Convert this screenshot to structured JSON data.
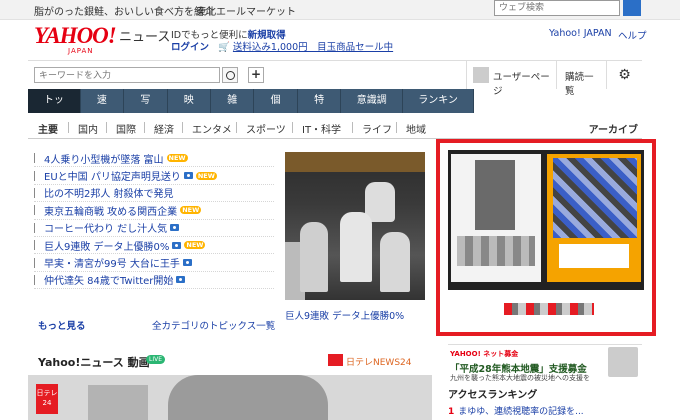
{
  "top_strip": {
    "promo": "脂がのった銀鮭、おいしい食べ方を紹介",
    "promo2": "東北エールマーケット",
    "web_search_placeholder": "ウェブ検索"
  },
  "header": {
    "logo_text": "YAHOO!",
    "logo_sub": "JAPAN",
    "logo_service": "ニュース",
    "id_prefix": "IDでもっと便利に",
    "id_link": "新規取得",
    "login": "ログイン",
    "cart_icon": "cart-icon",
    "shipping_promo": "送料込み1,000円　目玉商品セール中",
    "yahoo_japan_link": "Yahoo! JAPAN",
    "help_link": "ヘルプ"
  },
  "search": {
    "placeholder": "キーワードを入力",
    "plus_label": "+",
    "user_page": "ユーザーページ",
    "subscription": "購読一覧",
    "gear_icon": "⚙"
  },
  "main_nav": [
    {
      "label": "トップ",
      "active": true
    },
    {
      "label": "速報"
    },
    {
      "label": "写真"
    },
    {
      "label": "映像"
    },
    {
      "label": "雑誌"
    },
    {
      "label": "個人"
    },
    {
      "label": "特集"
    },
    {
      "label": "意識調査"
    },
    {
      "label": "ランキング"
    }
  ],
  "sub_nav": [
    {
      "label": "主要",
      "active": true
    },
    {
      "label": "国内"
    },
    {
      "label": "国際"
    },
    {
      "label": "経済"
    },
    {
      "label": "エンタメ"
    },
    {
      "label": "スポーツ"
    },
    {
      "label": "IT・科学"
    },
    {
      "label": "ライフ"
    },
    {
      "label": "地域"
    }
  ],
  "archive": "アーカイブ",
  "topics": [
    {
      "text": "4人乗り小型機が墜落 富山",
      "badge": "NEW"
    },
    {
      "text": "EUと中国 パリ協定声明見送り",
      "camera": true,
      "badge": "NEW"
    },
    {
      "text": "比の不明2邦人 射殺体で発見"
    },
    {
      "text": "東京五輪商戦 攻める関西企業",
      "badge": "NEW"
    },
    {
      "text": "コーヒー代わり だし汁人気",
      "camera": true
    },
    {
      "text": "巨人9連敗 データ上優勝0%",
      "camera": true,
      "badge": "NEW"
    },
    {
      "text": "早実・清宮が99号 大台に王手",
      "camera": true
    },
    {
      "text": "仲代達矢 84歳でTwitter開始",
      "camera": true
    }
  ],
  "more_link": "もっと見る",
  "all_topics_link": "全カテゴリのトピックス一覧",
  "photo_caption": "巨人9連敗 データ上優勝0%",
  "video": {
    "title": "Yahoo!ニュース 動画",
    "live": "LIVE",
    "source": "日テレNEWS24",
    "channel_badge": "日テレ24"
  },
  "relief": {
    "yahoo": "YAHOO! ネット募金",
    "title": "「平成28年熊本地震」支援募金",
    "sub": "九州を襲った熊本大地震の被災地への支援を"
  },
  "access_ranking": {
    "title": "アクセスランキング",
    "first": {
      "rank": "1",
      "text": "まゆゆ、連続視聴率の記録を..."
    }
  }
}
